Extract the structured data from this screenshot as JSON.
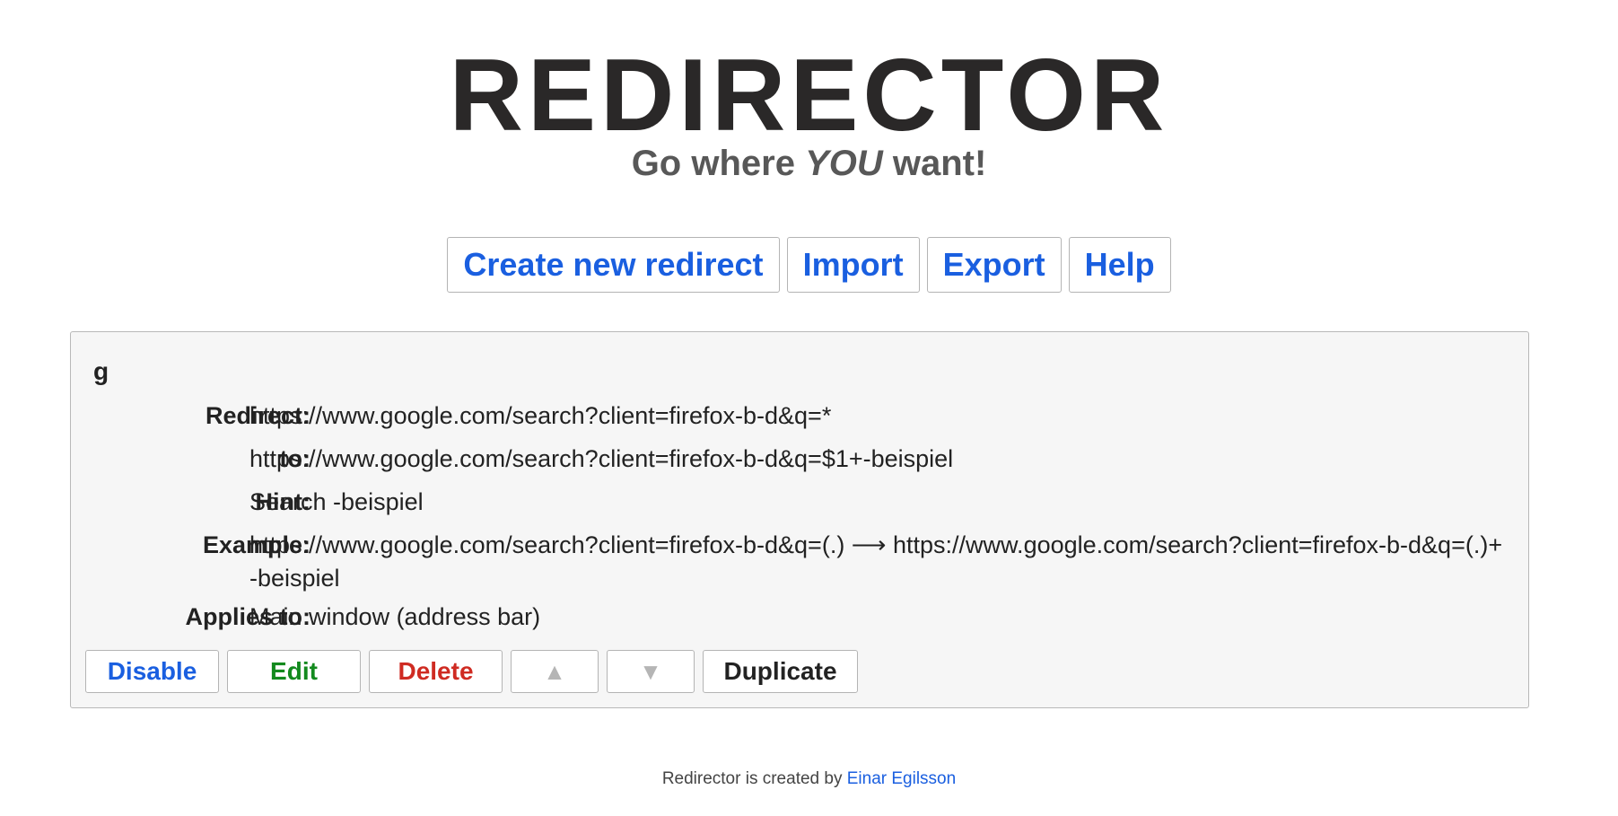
{
  "header": {
    "title": "REDIRECTOR",
    "tagline_before": "Go where ",
    "tagline_emphasis": "YOU",
    "tagline_after": " want!"
  },
  "menu": {
    "create_label": "Create new redirect",
    "import_label": "Import",
    "export_label": "Export",
    "help_label": "Help"
  },
  "redirect": {
    "name": "g",
    "redirect_label": "Redirect:",
    "redirect_value": "https://www.google.com/search?client=firefox-b-d&q=*",
    "to_label": "to:",
    "to_value": "https://www.google.com/search?client=firefox-b-d&q=$1+-beispiel",
    "hint_label": "Hint:",
    "hint_value": "Search -beispiel",
    "example_label": "Example:",
    "example_value": "https://www.google.com/search?client=firefox-b-d&q=(.) ⟶ https://www.google.com/search?client=firefox-b-d&q=(.)+-beispiel",
    "applies_label": "Applies to:",
    "applies_value": "Main window (address bar)"
  },
  "actions": {
    "disable_label": "Disable",
    "edit_label": "Edit",
    "delete_label": "Delete",
    "move_up_label": "▲",
    "move_down_label": "▼",
    "duplicate_label": "Duplicate"
  },
  "footer": {
    "text": "Redirector is created by ",
    "author_link": "Einar Egilsson"
  },
  "colors": {
    "link_blue": "#1a5fe0",
    "edit_green": "#138a1e",
    "delete_red": "#cf2b22",
    "disabled_gray": "#b5b5b5",
    "card_background": "#f6f6f6"
  }
}
